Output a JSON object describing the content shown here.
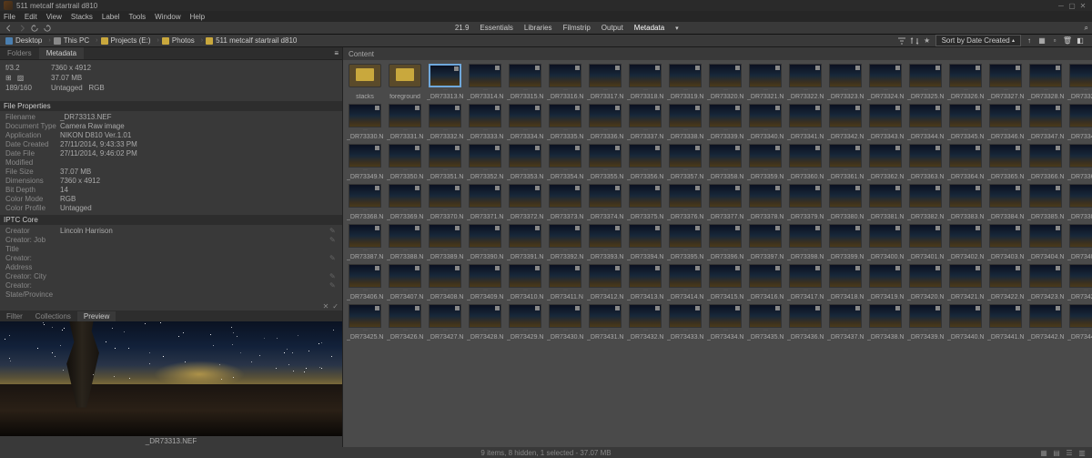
{
  "titlebar": {
    "title": "511 metcalf startrail d810"
  },
  "menus": [
    "File",
    "Edit",
    "View",
    "Stacks",
    "Label",
    "Tools",
    "Window",
    "Help"
  ],
  "toolbar": {
    "scale": "21.9",
    "workspaces": [
      "Essentials",
      "Libraries",
      "Filmstrip",
      "Output",
      "Metadata"
    ]
  },
  "breadcrumb": {
    "crumbs": [
      {
        "label": "Desktop",
        "type": "desktop"
      },
      {
        "label": "This PC",
        "type": "pc"
      },
      {
        "label": "Projects (E:)",
        "type": "folder"
      },
      {
        "label": "Photos",
        "type": "folder"
      },
      {
        "label": "511 metcalf startrail d810",
        "type": "folder"
      }
    ],
    "sort_label": "Sort by Date Created"
  },
  "panel_tabs": {
    "folders": "Folders",
    "metadata": "Metadata"
  },
  "metadata_top": {
    "fstop": "f/3.2",
    "iso": "ISO",
    "dim": "7360 x 4912",
    "size": "37.07 MB",
    "flash": "189/160",
    "untagged": "Untagged",
    "rgb": "RGB"
  },
  "file_properties_section": "File Properties",
  "file_properties": [
    {
      "label": "Filename",
      "value": "_DR73313.NEF"
    },
    {
      "label": "Document Type",
      "value": "Camera Raw image"
    },
    {
      "label": "Application",
      "value": "NIKON D810 Ver.1.01"
    },
    {
      "label": "Date Created",
      "value": "27/11/2014, 9:43:33 PM"
    },
    {
      "label": "Date File Modified",
      "value": "27/11/2014, 9:46:02 PM"
    },
    {
      "label": "File Size",
      "value": "37.07 MB"
    },
    {
      "label": "Dimensions",
      "value": "7360 x 4912"
    },
    {
      "label": "Bit Depth",
      "value": "14"
    },
    {
      "label": "Color Mode",
      "value": "RGB"
    },
    {
      "label": "Color Profile",
      "value": "Untagged"
    }
  ],
  "iptc_section": "IPTC Core",
  "iptc": [
    {
      "label": "Creator",
      "value": "Lincoln Harrison",
      "edit": true
    },
    {
      "label": "Creator: Job Title",
      "value": "",
      "edit": true
    },
    {
      "label": "Creator: Address",
      "value": "",
      "edit": true
    },
    {
      "label": "Creator: City",
      "value": "",
      "edit": true
    },
    {
      "label": "Creator: State/Province",
      "value": "",
      "edit": true
    }
  ],
  "subtabs": {
    "filter": "Filter",
    "collections": "Collections",
    "preview": "Preview"
  },
  "preview_caption": "_DR73313.NEF",
  "content_header": "Content",
  "folders": [
    {
      "name": "stacks"
    },
    {
      "name": "foreground"
    }
  ],
  "thumb_start": 3313,
  "thumb_count": 131,
  "thumb_prefix": "_DR7",
  "thumb_suffix": ".NEF",
  "selected_thumb": 3313,
  "statusbar": {
    "center": "9 items, 8 hidden, 1 selected - 37.07 MB"
  }
}
